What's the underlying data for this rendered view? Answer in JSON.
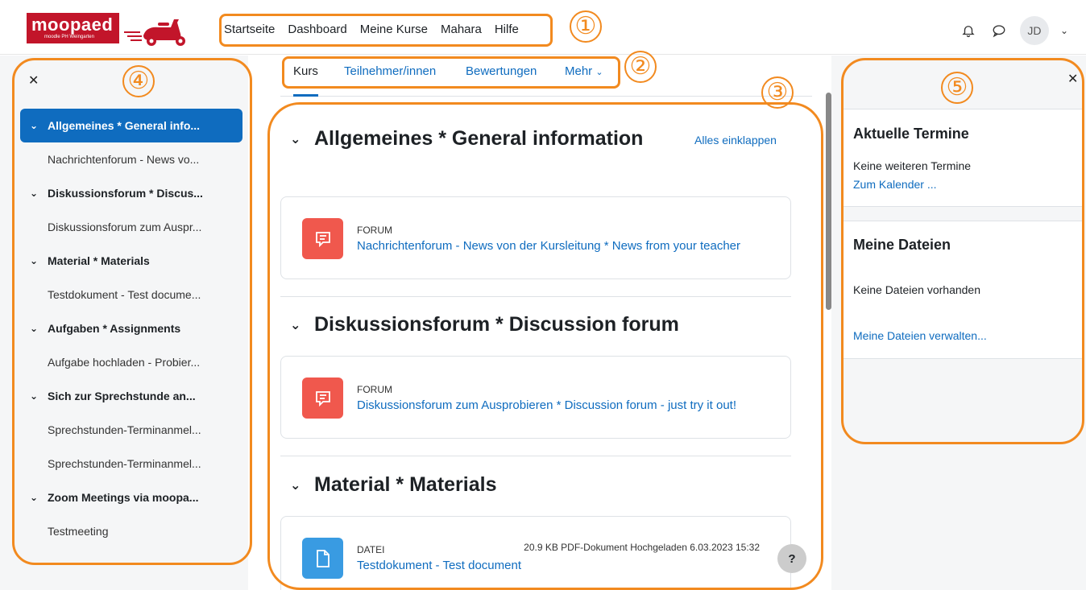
{
  "header": {
    "logo_text": "moopaed",
    "logo_subtext": "moodle PH Weingarten",
    "nav": [
      "Startseite",
      "Dashboard",
      "Meine Kurse",
      "Mahara",
      "Hilfe"
    ],
    "user_initials": "JD"
  },
  "annotations": [
    "①",
    "②",
    "③",
    "④",
    "⑤"
  ],
  "secondary_nav": {
    "tabs": [
      "Kurs",
      "Teilnehmer/innen",
      "Bewertungen",
      "Mehr"
    ]
  },
  "course_index": {
    "items": [
      {
        "type": "section",
        "label": "Allgemeines * General info..."
      },
      {
        "type": "activity",
        "label": "Nachrichtenforum - News vo..."
      },
      {
        "type": "section",
        "label": "Diskussionsforum * Discus..."
      },
      {
        "type": "activity",
        "label": "Diskussionsforum zum Auspr..."
      },
      {
        "type": "section",
        "label": "Material * Materials"
      },
      {
        "type": "activity",
        "label": "Testdokument - Test docume..."
      },
      {
        "type": "section",
        "label": "Aufgaben * Assignments"
      },
      {
        "type": "activity",
        "label": "Aufgabe hochladen - Probier..."
      },
      {
        "type": "section",
        "label": "Sich zur Sprechstunde an..."
      },
      {
        "type": "activity",
        "label": "Sprechstunden-Terminanmel..."
      },
      {
        "type": "activity",
        "label": "Sprechstunden-Terminanmel..."
      },
      {
        "type": "section",
        "label": "Zoom Meetings via moopa..."
      },
      {
        "type": "activity",
        "label": "Testmeeting"
      }
    ]
  },
  "main": {
    "collapse_all": "Alles einklappen",
    "sections": [
      {
        "title": "Allgemeines * General information",
        "activity": {
          "type": "FORUM",
          "name": "Nachrichtenforum - News von der Kursleitung * News from your teacher"
        }
      },
      {
        "title": "Diskussionsforum * Discussion forum",
        "activity": {
          "type": "FORUM",
          "name": "Diskussionsforum zum Ausprobieren * Discussion forum - just try it out!"
        }
      },
      {
        "title": "Material * Materials",
        "activity": {
          "type": "DATEI",
          "name": "Testdokument - Test document",
          "meta": "20.9 KB PDF-Dokument Hochgeladen 6.03.2023 15:32"
        }
      }
    ],
    "help": "?"
  },
  "right_drawer": {
    "blocks": [
      {
        "title": "Aktuelle Termine",
        "text": "Keine weiteren Termine",
        "link": "Zum Kalender ..."
      },
      {
        "title": "Meine Dateien",
        "text": "Keine Dateien vorhanden",
        "link": "Meine Dateien verwalten..."
      }
    ]
  },
  "colors": {
    "accent": "#0f6cbf",
    "annotation": "#f28a1f",
    "forum_icon": "#f0584d",
    "file_icon": "#399be2",
    "brand": "#c2152a"
  }
}
